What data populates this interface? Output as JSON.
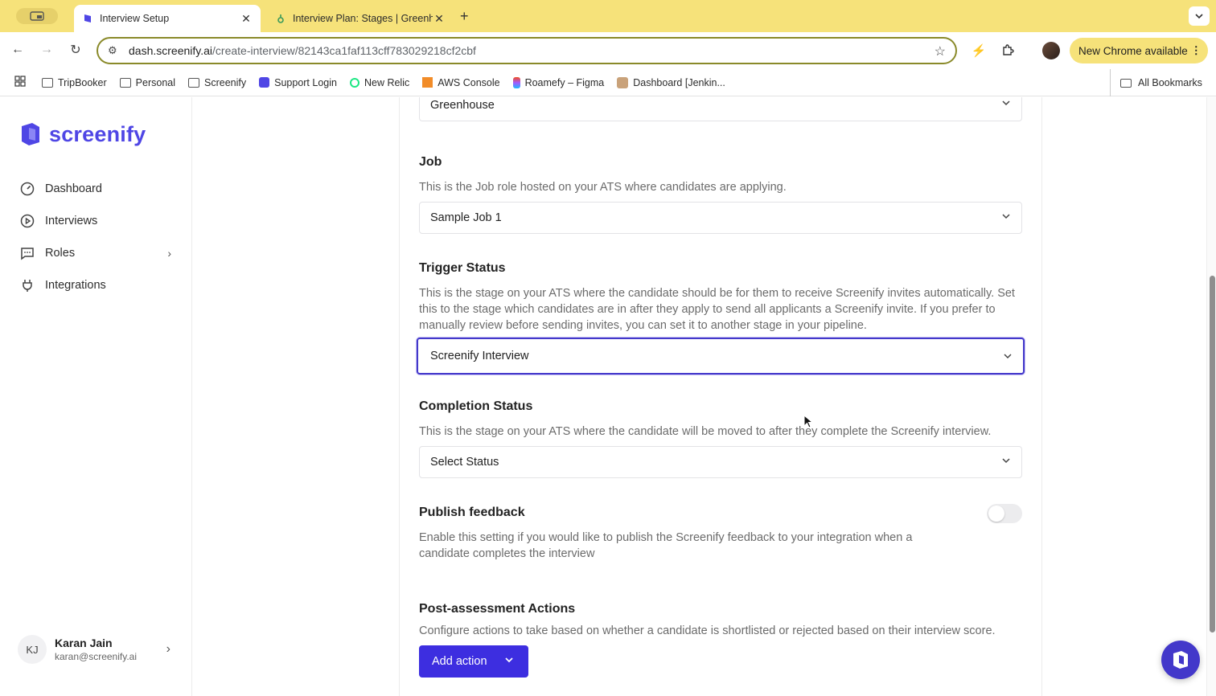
{
  "browser": {
    "tabs": [
      {
        "title": "Interview Setup",
        "close": "✕"
      },
      {
        "title": "Interview Plan: Stages | Greenhouse",
        "close": "✕"
      }
    ],
    "new_tab": "+",
    "url_host": "dash.screenify.ai",
    "url_path": "/create-interview/82143ca1faf113cff783029218cf2cbf",
    "update_label": "New Chrome available",
    "bookmarks": [
      "TripBooker",
      "Personal",
      "Screenify",
      "Support Login",
      "New Relic",
      "AWS Console",
      "Roamefy – Figma",
      "Dashboard [Jenkin..."
    ],
    "all_bookmarks": "All Bookmarks"
  },
  "sidebar": {
    "brand": "screenify",
    "items": [
      {
        "label": "Dashboard",
        "icon": "gauge-icon"
      },
      {
        "label": "Interviews",
        "icon": "play-circle-icon"
      },
      {
        "label": "Roles",
        "icon": "message-square-icon"
      },
      {
        "label": "Integrations",
        "icon": "plug-icon"
      }
    ],
    "user": {
      "initials": "KJ",
      "name": "Karan Jain",
      "email": "karan@screenify.ai"
    }
  },
  "form": {
    "ats_value": "Greenhouse",
    "job": {
      "label": "Job",
      "description": "This is the Job role hosted on your ATS where candidates are applying.",
      "value": "Sample Job 1"
    },
    "trigger": {
      "label": "Trigger Status",
      "description": "This is the stage on your ATS where the candidate should be for them to receive Screenify invites automatically. Set this to the stage which candidates are in after they apply to send all applicants a Screenify invite. If you prefer to manually review before sending invites, you can set it to another stage in your pipeline.",
      "value": "Screenify Interview"
    },
    "completion": {
      "label": "Completion Status",
      "description": "This is the stage on your ATS where the candidate will be moved to after they complete the Screenify interview.",
      "value": "Select Status"
    },
    "publish": {
      "label": "Publish feedback",
      "description": "Enable this setting if you would like to publish the Screenify feedback to your integration when a candidate completes the interview",
      "enabled": false
    },
    "post": {
      "label": "Post-assessment Actions",
      "description": "Configure actions to take based on whether a candidate is shortlisted or rejected based on their interview score.",
      "button": "Add action"
    }
  },
  "colors": {
    "brand": "#4f46e5",
    "button": "#3d2ee0",
    "chrome_bar": "#f6e27a"
  }
}
